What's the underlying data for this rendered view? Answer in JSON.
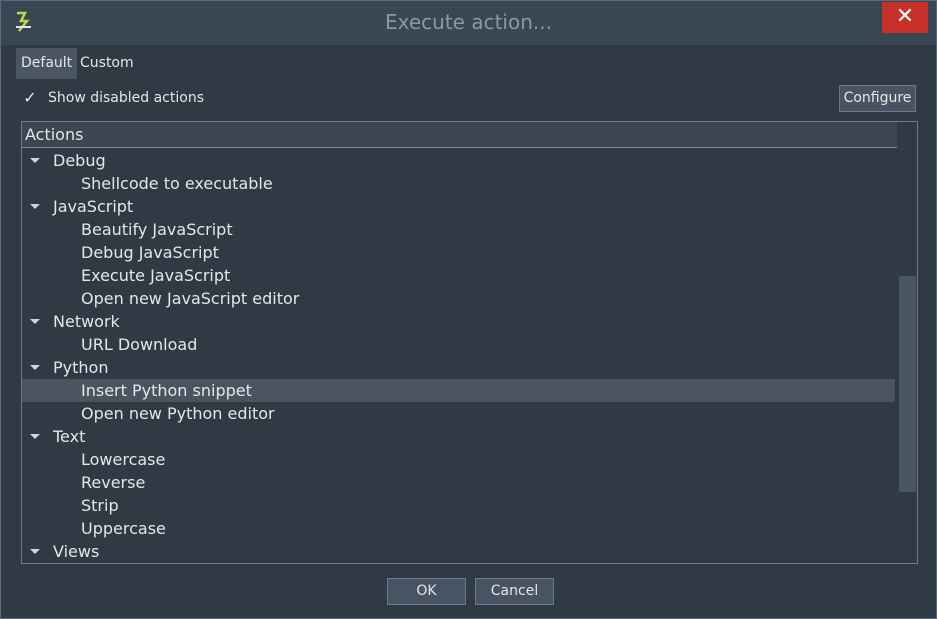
{
  "window": {
    "title": "Execute action..."
  },
  "tabs": [
    {
      "label": "Default",
      "active": true
    },
    {
      "label": "Custom",
      "active": false
    }
  ],
  "options": {
    "show_disabled_label": "Show disabled actions",
    "show_disabled_checked": true,
    "configure_label": "Configure"
  },
  "tree": {
    "header": "Actions",
    "selected": "Insert Python snippet",
    "scroll_position": 0.62,
    "groups": [
      {
        "label": "Debug",
        "items": [
          "Shellcode to executable"
        ]
      },
      {
        "label": "JavaScript",
        "items": [
          "Beautify JavaScript",
          "Debug JavaScript",
          "Execute JavaScript",
          "Open new JavaScript editor"
        ]
      },
      {
        "label": "Network",
        "items": [
          "URL Download"
        ]
      },
      {
        "label": "Python",
        "items": [
          "Insert Python snippet",
          "Open new Python editor"
        ]
      },
      {
        "label": "Text",
        "items": [
          "Lowercase",
          "Reverse",
          "Strip",
          "Uppercase"
        ]
      },
      {
        "label": "Views",
        "items": []
      }
    ]
  },
  "buttons": {
    "ok": "OK",
    "cancel": "Cancel"
  },
  "colors": {
    "close": "#c7312a",
    "selection": "#4a5460",
    "background": "#2f3a45"
  },
  "icons": {
    "app": "app-icon",
    "close": "close-icon",
    "check": "checkmark-icon",
    "expand": "chevron-down-icon"
  }
}
